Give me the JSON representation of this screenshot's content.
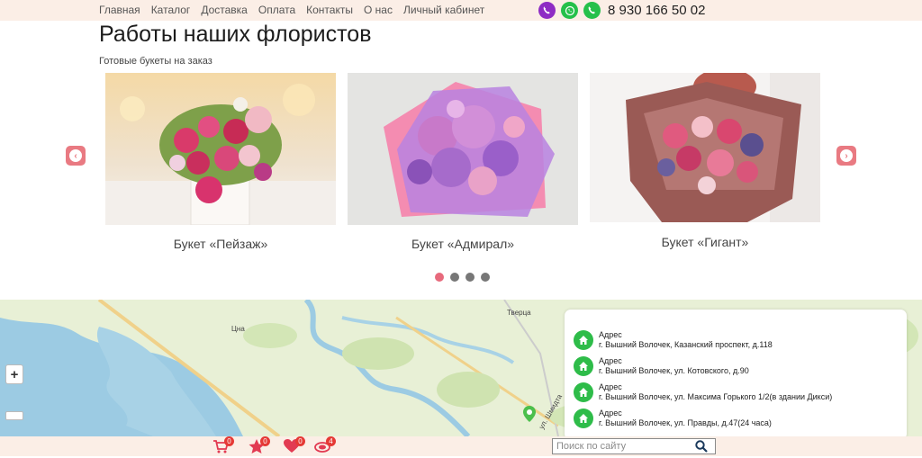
{
  "nav": {
    "items": [
      "Главная",
      "Каталог",
      "Доставка",
      "Оплата",
      "Контакты",
      "О нас",
      "Личный кабинет"
    ]
  },
  "contacts": {
    "phone": "8 930 166 50 02",
    "icons": [
      "viber-icon",
      "whatsapp-icon",
      "phone-icon"
    ]
  },
  "section": {
    "title": "Работы наших флористов",
    "subtitle": "Готовые букеты на заказ"
  },
  "carousel": {
    "items": [
      {
        "caption": "Букет «Пейзаж»"
      },
      {
        "caption": "Букет «Адмирал»"
      },
      {
        "caption": "Букет «Гигант»"
      }
    ],
    "dots_count": 4,
    "active_dot": 0
  },
  "map": {
    "labels": [
      "Цна",
      "Тверца",
      "ул. Шмидта"
    ],
    "addresses": [
      {
        "title": "Адрес",
        "text": "г. Вышний Волочек, Казанский проспект, д.118"
      },
      {
        "title": "Адрес",
        "text": "г. Вышний Волочек, ул. Котовского, д.90"
      },
      {
        "title": "Адрес",
        "text": "г. Вышний Волочек, ул. Максима Горького 1/2(в здании Дикси)"
      },
      {
        "title": "Адрес",
        "text": "г. Вышний Волочек, ул. Правды, д.47(24 часа)"
      }
    ]
  },
  "bottom": {
    "cart_count": "0",
    "favorites_count": "0",
    "wishlist_count": "0",
    "compare_count": "4",
    "search_placeholder": "Поиск по сайту"
  },
  "colors": {
    "bar_bg": "#fbeee6",
    "accent_pink": "#e97a82",
    "green": "#2ebc49"
  }
}
